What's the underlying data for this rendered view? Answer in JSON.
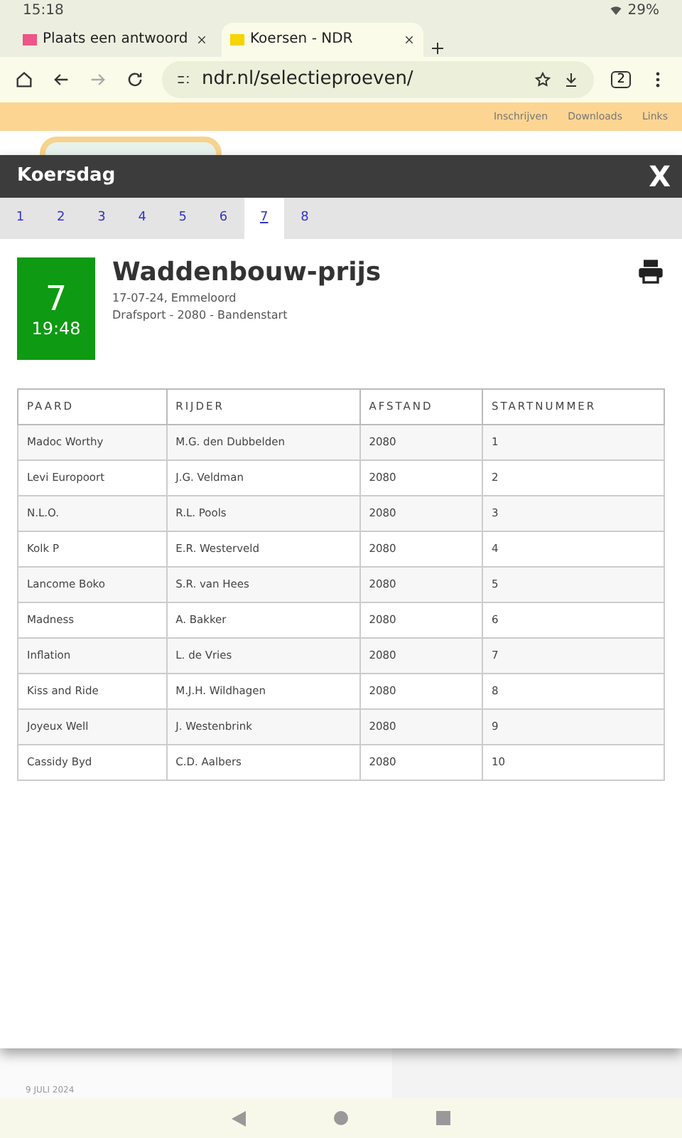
{
  "status_bar": {
    "time": "15:18",
    "battery": "29%"
  },
  "browser_tabs": [
    {
      "title": "Plaats een antwoord",
      "selected": false
    },
    {
      "title": "Koersen - NDR",
      "selected": true
    }
  ],
  "address_bar": {
    "url": "ndr.nl/selectieproeven/",
    "tab_count": "2"
  },
  "site_nav": [
    "Inschrijven",
    "Downloads",
    "Links"
  ],
  "modal": {
    "title": "Koersdag",
    "close": "X",
    "race_tabs": [
      {
        "label": "1",
        "selected": false
      },
      {
        "label": "2",
        "selected": false
      },
      {
        "label": "3",
        "selected": false
      },
      {
        "label": "4",
        "selected": false
      },
      {
        "label": "5",
        "selected": false
      },
      {
        "label": "6",
        "selected": false
      },
      {
        "label": "7",
        "selected": true
      },
      {
        "label": "8",
        "selected": false
      }
    ],
    "race": {
      "number": "7",
      "time": "19:48",
      "name": "Waddenbouw-prijs",
      "date_place": "17-07-24, Emmeloord",
      "details": "Drafsport - 2080 - Bandenstart"
    },
    "table": {
      "columns": [
        "PAARD",
        "RIJDER",
        "AFSTAND",
        "STARTNUMMER"
      ],
      "rows": [
        [
          "Madoc Worthy",
          "M.G. den Dubbelden",
          "2080",
          "1"
        ],
        [
          "Levi Europoort",
          "J.G. Veldman",
          "2080",
          "2"
        ],
        [
          "N.L.O.",
          "R.L. Pools",
          "2080",
          "3"
        ],
        [
          "Kolk P",
          "E.R. Westerveld",
          "2080",
          "4"
        ],
        [
          "Lancome Boko",
          "S.R. van Hees",
          "2080",
          "5"
        ],
        [
          "Madness",
          "A. Bakker",
          "2080",
          "6"
        ],
        [
          "Inflation",
          "L. de Vries",
          "2080",
          "7"
        ],
        [
          "Kiss and Ride",
          "M.J.H. Wildhagen",
          "2080",
          "8"
        ],
        [
          "Joyeux Well",
          "J. Westenbrink",
          "2080",
          "9"
        ],
        [
          "Cassidy Byd",
          "C.D. Aalbers",
          "2080",
          "10"
        ]
      ]
    }
  },
  "background_news": {
    "date": "9 JULI 2024"
  }
}
